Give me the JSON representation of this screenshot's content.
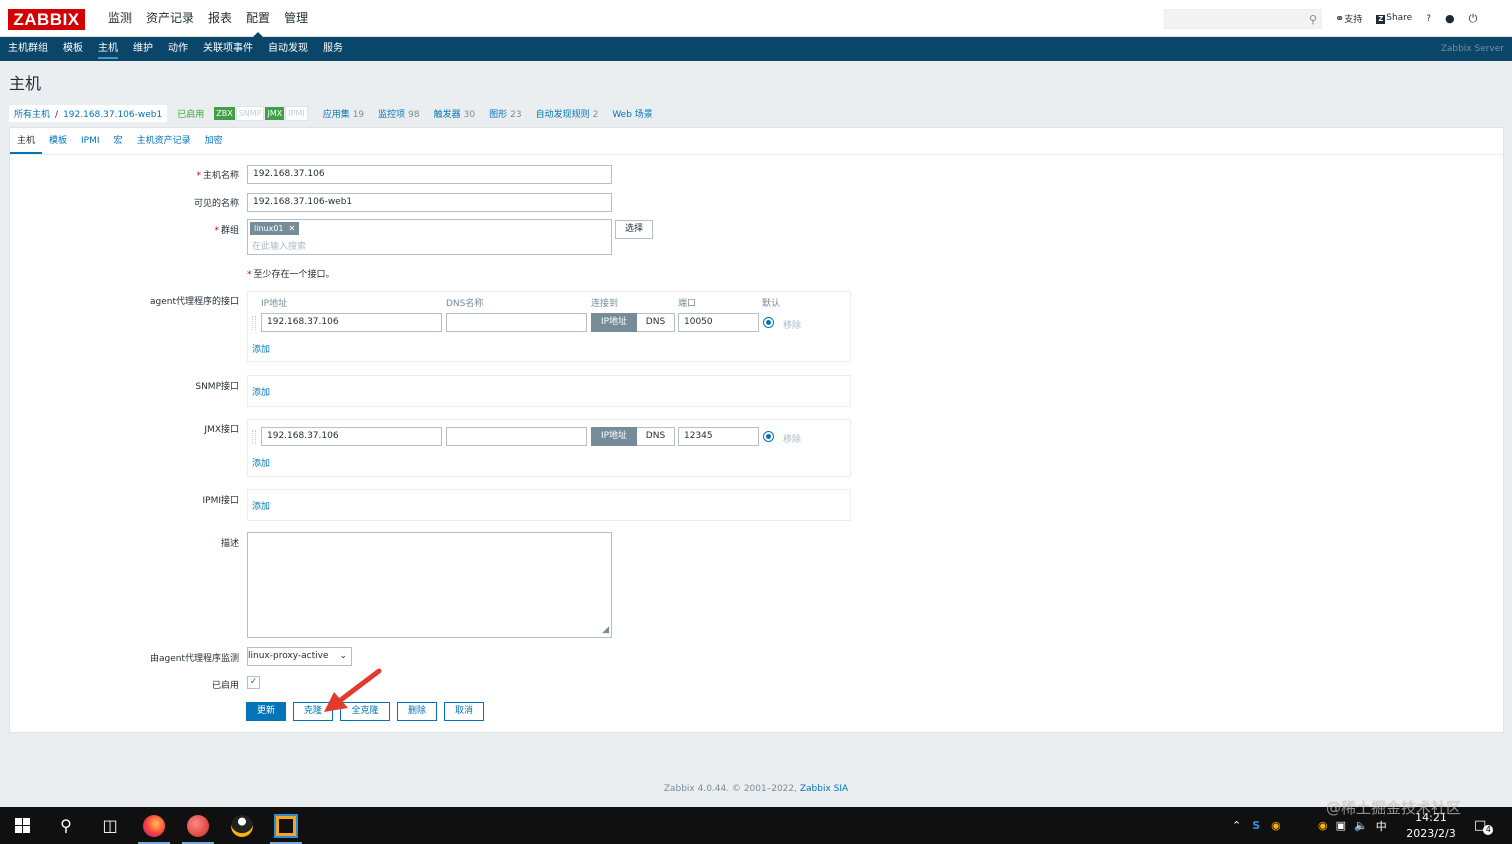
{
  "brand": {
    "logo": "ZABBIX",
    "color": "#d40000"
  },
  "main_nav": [
    {
      "label": "监测"
    },
    {
      "label": "资产记录"
    },
    {
      "label": "报表"
    },
    {
      "label": "配置",
      "active": true
    },
    {
      "label": "管理"
    }
  ],
  "top_links": {
    "support": "支持",
    "share": "Share",
    "help": "?"
  },
  "sub_nav": {
    "items": [
      "主机群组",
      "模板",
      "主机",
      "维护",
      "动作",
      "关联项事件",
      "自动发现",
      "服务"
    ],
    "active": "主机",
    "server": "Zabbix Server"
  },
  "page_title": "主机",
  "breadcrumb": {
    "all_hosts": "所有主机",
    "separator": "/",
    "current": "192.168.37.106-web1",
    "status": "已启用",
    "badges": [
      {
        "label": "ZBX",
        "on": true
      },
      {
        "label": "SNMP",
        "on": false
      },
      {
        "label": "JMX",
        "on": true
      },
      {
        "label": "IPMI",
        "on": false
      }
    ],
    "stats": [
      {
        "label": "应用集",
        "count": "19"
      },
      {
        "label": "监控项",
        "count": "98"
      },
      {
        "label": "触发器",
        "count": "30"
      },
      {
        "label": "图形",
        "count": "23"
      },
      {
        "label": "自动发现规则",
        "count": "2"
      },
      {
        "label": "Web 场景",
        "count": ""
      }
    ]
  },
  "tabs": [
    "主机",
    "模板",
    "IPMI",
    "宏",
    "主机资产记录",
    "加密"
  ],
  "form": {
    "host_name_label": "主机名称",
    "host_name": "192.168.37.106",
    "visible_name_label": "可见的名称",
    "visible_name": "192.168.37.106-web1",
    "groups_label": "群组",
    "group_tag": "linux01",
    "group_placeholder": "在此输入搜索",
    "select_button": "选择",
    "interface_note": "至少存在一个接口。",
    "agent_if_label": "agent代理程序的接口",
    "columns": {
      "ip": "IP地址",
      "dns": "DNS名称",
      "connect": "连接到",
      "port": "端口",
      "default": "默认"
    },
    "agent_interface": {
      "ip": "192.168.37.106",
      "dns": "",
      "connect_ip": "IP地址",
      "connect_dns": "DNS",
      "port": "10050",
      "remove": "移除"
    },
    "snmp_label": "SNMP接口",
    "jmx_label": "JMX接口",
    "jmx_interface": {
      "ip": "192.168.37.106",
      "dns": "",
      "connect_ip": "IP地址",
      "connect_dns": "DNS",
      "port": "12345",
      "remove": "移除"
    },
    "ipmi_label": "IPMI接口",
    "add_link": "添加",
    "description_label": "描述",
    "proxy_label": "由agent代理程序监测",
    "proxy_value": "linux-proxy-active",
    "enabled_label": "已启用",
    "enabled": true,
    "buttons": {
      "update": "更新",
      "clone": "克隆",
      "full_clone": "全克隆",
      "delete": "删除",
      "cancel": "取消"
    }
  },
  "footer": {
    "text": "Zabbix 4.0.44. © 2001–2022, ",
    "company": "Zabbix SIA"
  },
  "watermark": "@稀土掘金技术社区",
  "taskbar": {
    "time": "14:21",
    "date": "2023/2/3",
    "ime": "中",
    "notifications": "4"
  }
}
